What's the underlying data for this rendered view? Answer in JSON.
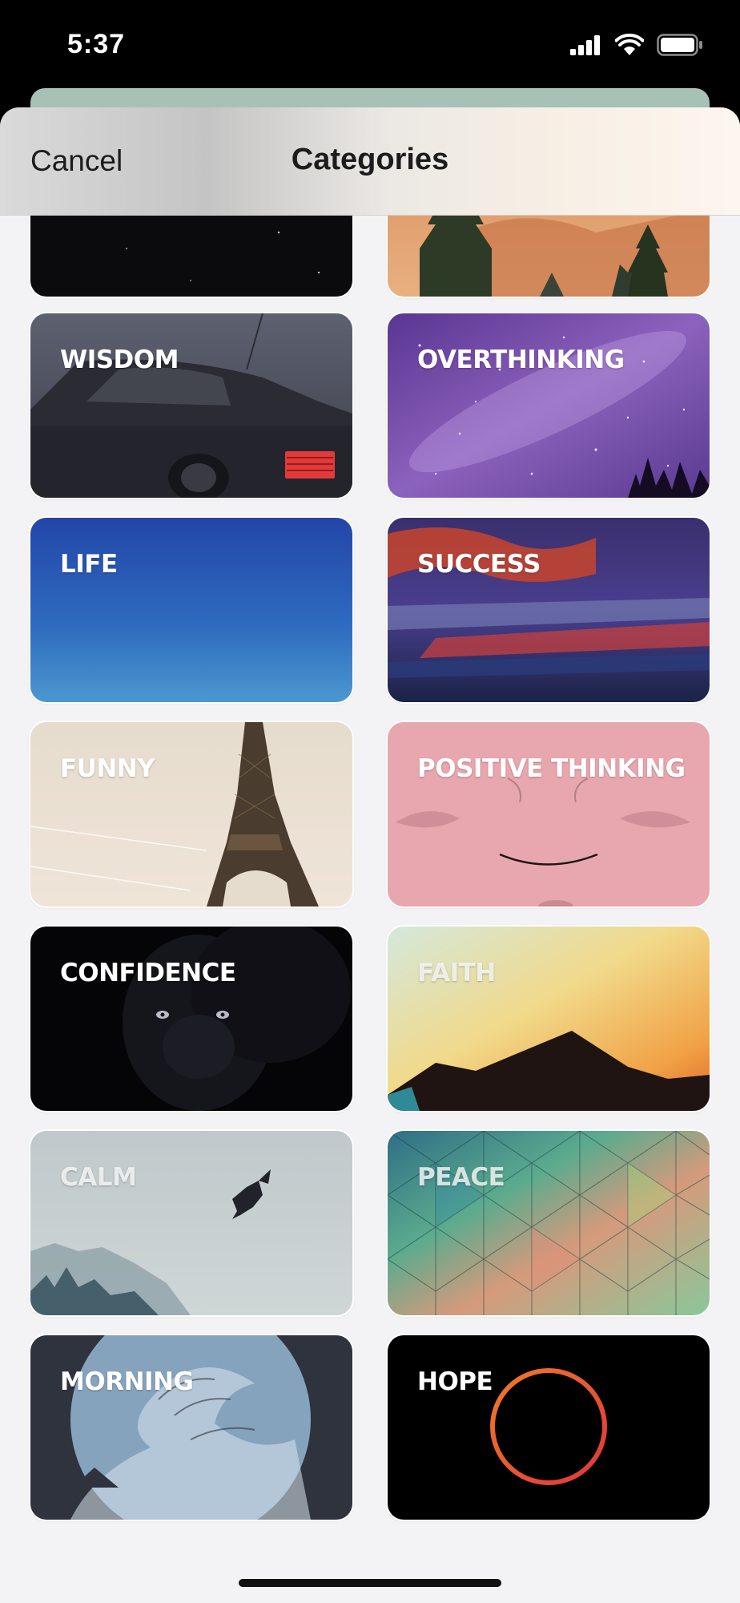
{
  "status": {
    "time": "5:37"
  },
  "nav": {
    "cancel_label": "Cancel",
    "title": "Categories"
  },
  "categories": [
    {
      "label": ""
    },
    {
      "label": ""
    },
    {
      "label": "WISDOM"
    },
    {
      "label": "OVERTHINKING"
    },
    {
      "label": "LIFE"
    },
    {
      "label": "SUCCESS"
    },
    {
      "label": "FUNNY"
    },
    {
      "label": "POSITIVE THINKING"
    },
    {
      "label": "CONFIDENCE"
    },
    {
      "label": "FAITH"
    },
    {
      "label": "CALM"
    },
    {
      "label": "PEACE"
    },
    {
      "label": "MORNING"
    },
    {
      "label": "HOPE"
    }
  ]
}
